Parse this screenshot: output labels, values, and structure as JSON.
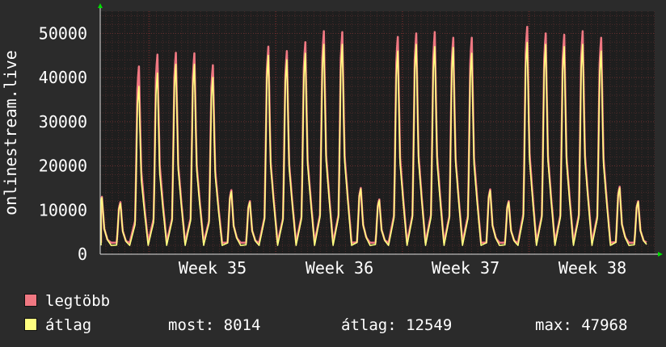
{
  "chart_data": {
    "type": "area",
    "ylabel": "onlinestream.live",
    "ylim": [
      0,
      55000
    ],
    "y_ticks": [
      0,
      10000,
      20000,
      30000,
      40000,
      50000
    ],
    "y_tick_labels": [
      "0",
      "10000",
      "20000",
      "30000",
      "40000",
      "50000"
    ],
    "x_tick_labels": [
      "Week 35",
      "Week 36",
      "Week 37",
      "Week 38"
    ],
    "grid": true,
    "series": [
      {
        "name": "legtöbb",
        "color": "#f07882",
        "daily_peaks": [
          13000,
          11800,
          42500,
          45200,
          45600,
          45500,
          42800,
          14500,
          12000,
          47000,
          46000,
          48000,
          50500,
          50300,
          15000,
          12400,
          49200,
          50000,
          50300,
          49000,
          49000,
          14700,
          12000,
          51500,
          50000,
          49700,
          50500,
          49000,
          15300,
          12000
        ]
      },
      {
        "name": "átlag",
        "color": "#ffff80",
        "daily_peaks": [
          12800,
          11500,
          38000,
          41000,
          43000,
          43000,
          40000,
          14200,
          11800,
          45000,
          44000,
          45500,
          47500,
          47500,
          14800,
          12200,
          46000,
          47500,
          47000,
          46800,
          45500,
          14400,
          11800,
          47968,
          47500,
          47000,
          47500,
          46000,
          15000,
          11900
        ]
      }
    ],
    "stats": {
      "most_label": "most:",
      "most_value": "8014",
      "atlag_label": "átlag:",
      "atlag_value": "12549",
      "max_label": "max:",
      "max_value": "47968"
    }
  },
  "colors": {
    "background": "#2b2b2b",
    "plot_background": "#1e1e1e",
    "grid": "#4a2a2a",
    "axis_arrow": "#00dd00"
  }
}
